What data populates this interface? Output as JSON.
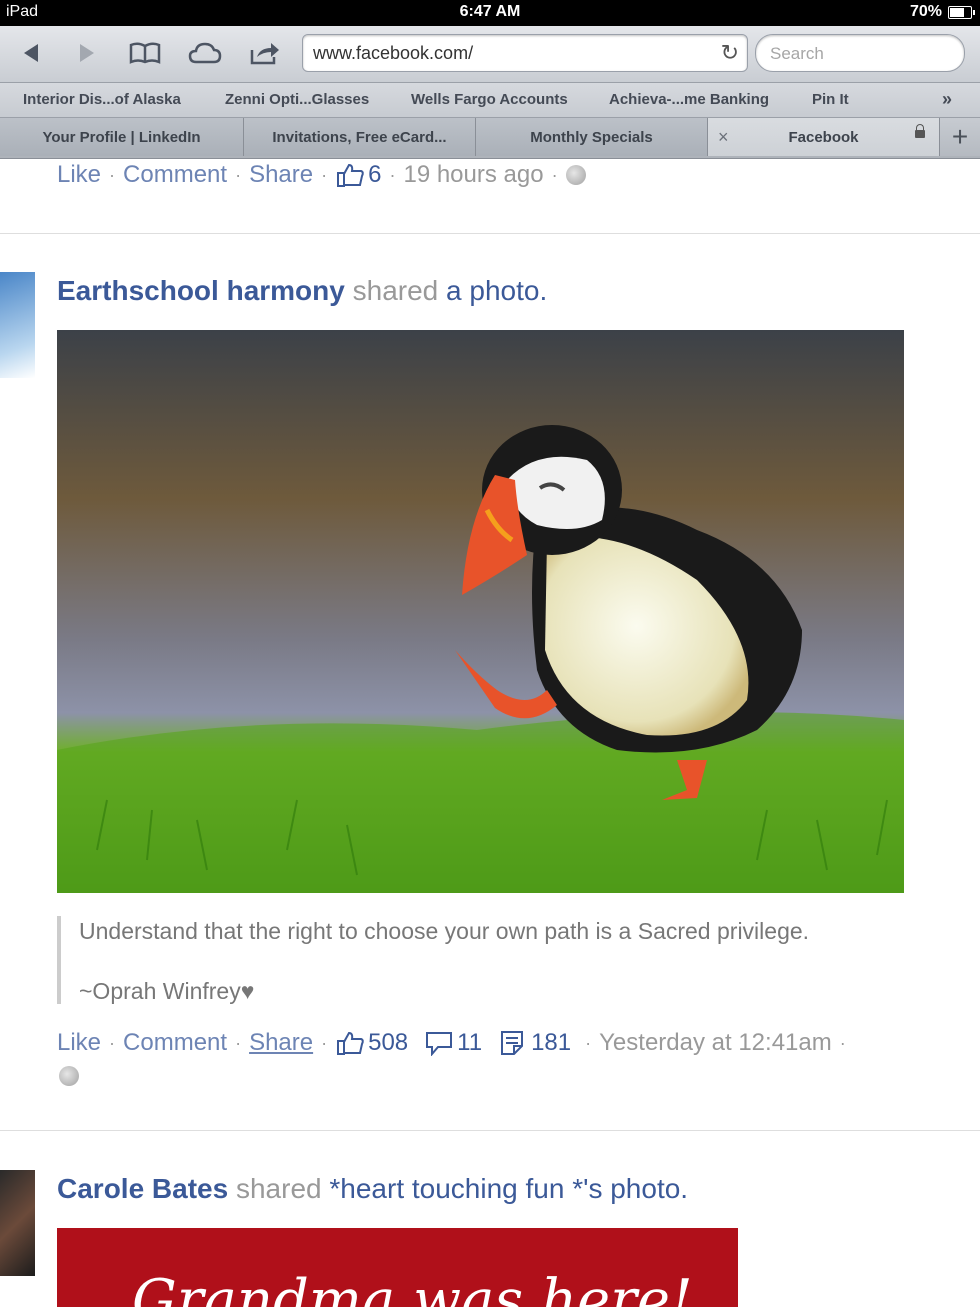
{
  "status_bar": {
    "device": "iPad",
    "time": "6:47 AM",
    "battery": "70%"
  },
  "browser": {
    "url": "www.facebook.com/",
    "search_placeholder": "Search",
    "bookmarks": [
      "Interior Dis...of Alaska",
      "Zenni Opti...Glasses",
      "Wells Fargo Accounts",
      "Achieva-...me Banking",
      "Pin It"
    ],
    "tabs": [
      "Your Profile | LinkedIn",
      "Invitations, Free eCard...",
      "Monthly Specials",
      "Facebook"
    ]
  },
  "feed": {
    "prev_post": {
      "like": "Like",
      "comment": "Comment",
      "share": "Share",
      "likes": "6",
      "time": "19 hours ago"
    },
    "post1": {
      "author": "Earthschool harmony",
      "verb": "shared",
      "object": "a photo.",
      "caption_line1": "Understand that the right to choose your own path is a Sacred privilege.",
      "caption_line2": "~Oprah Winfrey♥",
      "like": "Like",
      "comment": "Comment",
      "share": "Share",
      "likes": "508",
      "comments": "11",
      "shares": "181",
      "time": "Yesterday at 12:41am"
    },
    "post2": {
      "author": "Carole Bates",
      "verb": "shared",
      "object": "*heart touching fun *'s photo.",
      "photo_text": "Grandma was here!"
    }
  },
  "colors": {
    "link": "#3b5998",
    "action": "#6d84b4",
    "muted": "#999999"
  }
}
